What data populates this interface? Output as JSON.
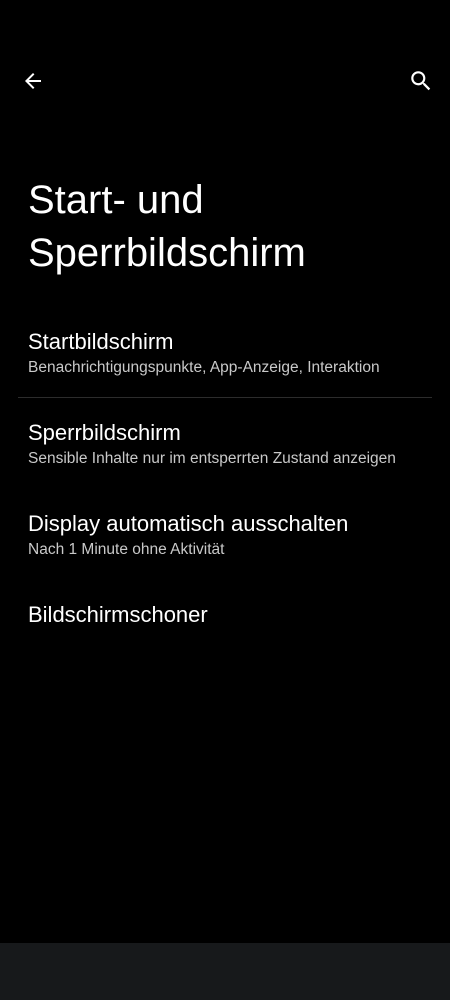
{
  "header": {
    "back_icon": "arrow-back-icon",
    "search_icon": "search-icon"
  },
  "page": {
    "title": "Start- und Sperrbildschirm"
  },
  "preferences": [
    {
      "title": "Startbildschirm",
      "summary": "Benachrichtigungspunkte, App-Anzeige, Interaktion"
    },
    {
      "title": "Sperrbildschirm",
      "summary": "Sensible Inhalte nur im entsperrten Zustand anzeigen"
    },
    {
      "title": "Display automatisch ausschalten",
      "summary": "Nach 1 Minute ohne Aktivität"
    },
    {
      "title": "Bildschirmschoner"
    }
  ],
  "colors": {
    "background": "#000000",
    "text_primary": "#ffffff",
    "text_secondary": "#c9c9c9",
    "divider": "#2c2c2c",
    "navigation_bar": "#17191b"
  }
}
